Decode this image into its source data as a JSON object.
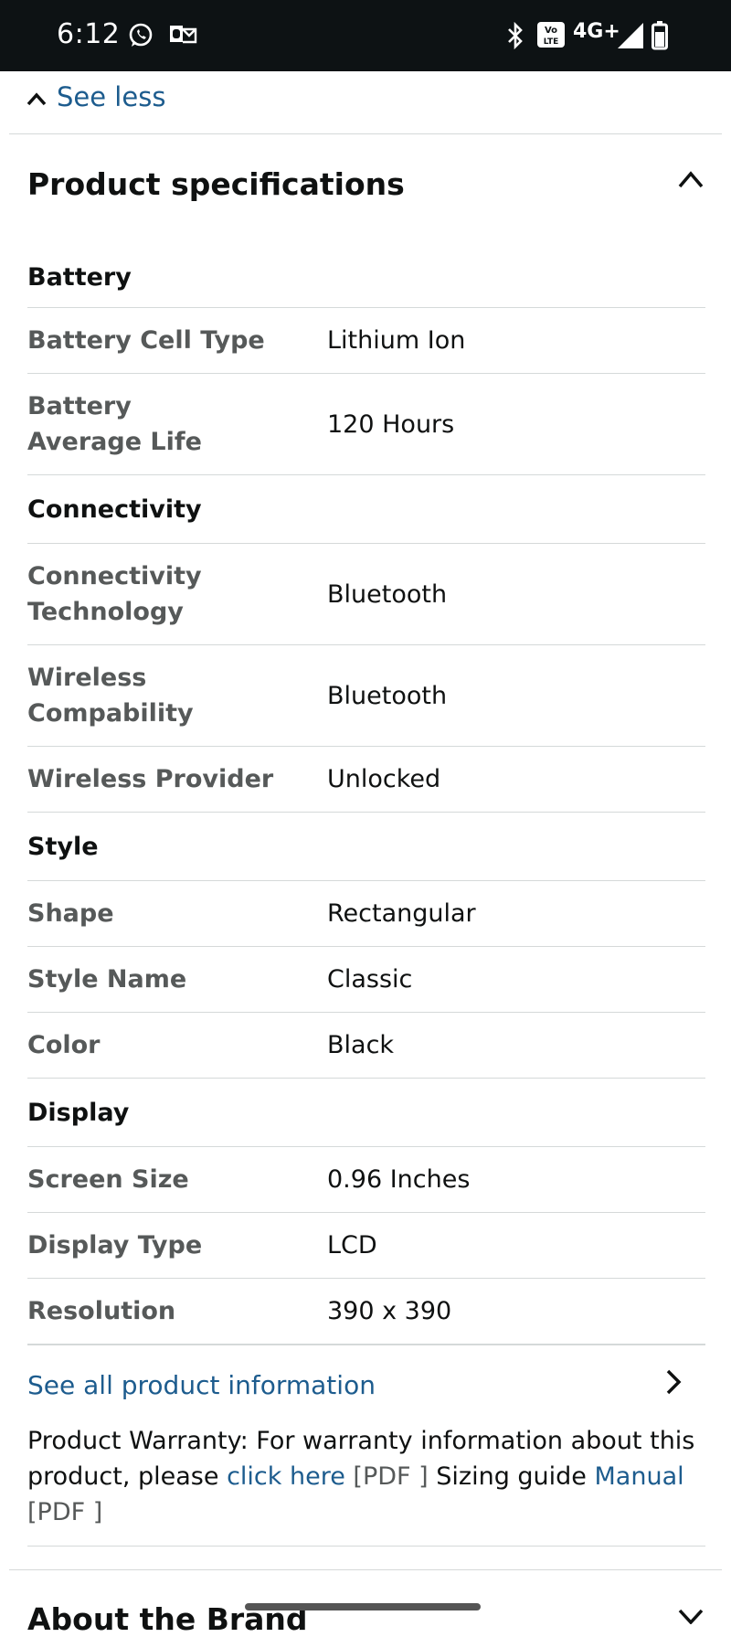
{
  "status_bar": {
    "time": "6:12",
    "network": "4G+",
    "volte_badge": "Vo LTE",
    "icons": [
      "whatsapp-icon",
      "outlook-icon",
      "bluetooth-icon",
      "volte-icon",
      "signal-icon",
      "battery-icon"
    ]
  },
  "see_less": {
    "label": "See less"
  },
  "product_specifications": {
    "title": "Product specifications",
    "groups": [
      {
        "heading": "Battery",
        "rows": [
          {
            "key": "Battery Cell Type",
            "value": "Lithium Ion"
          },
          {
            "key": "Battery Average Life",
            "value": "120 Hours"
          }
        ]
      },
      {
        "heading": "Connectivity",
        "rows": [
          {
            "key": "Connectivity Technology",
            "value": "Bluetooth"
          },
          {
            "key": "Wireless Compability",
            "value": "Bluetooth"
          },
          {
            "key": "Wireless Provider",
            "value": "Unlocked"
          }
        ]
      },
      {
        "heading": "Style",
        "rows": [
          {
            "key": "Shape",
            "value": "Rectangular"
          },
          {
            "key": "Style Name",
            "value": "Classic"
          },
          {
            "key": "Color",
            "value": "Black"
          }
        ]
      },
      {
        "heading": "Display",
        "rows": [
          {
            "key": "Screen Size",
            "value": "0.96 Inches"
          },
          {
            "key": "Display Type",
            "value": "LCD"
          },
          {
            "key": "Resolution",
            "value": "390 x 390"
          }
        ]
      }
    ]
  },
  "see_all": {
    "label": "See all product information"
  },
  "warranty": {
    "text_1": "Product Warranty: For warranty information about this product, please ",
    "link_click_here": "click here",
    "pdf_1": " [PDF ] ",
    "text_2": "Sizing guide ",
    "link_manual": "Manual",
    "pdf_2": " [PDF ]"
  },
  "about_brand": {
    "title": "About the Brand"
  },
  "colors": {
    "link": "#1d5c8e",
    "text": "#0f1111",
    "muted": "#565959",
    "status_bar": "#0d1214",
    "divider": "#d5d9d9"
  }
}
